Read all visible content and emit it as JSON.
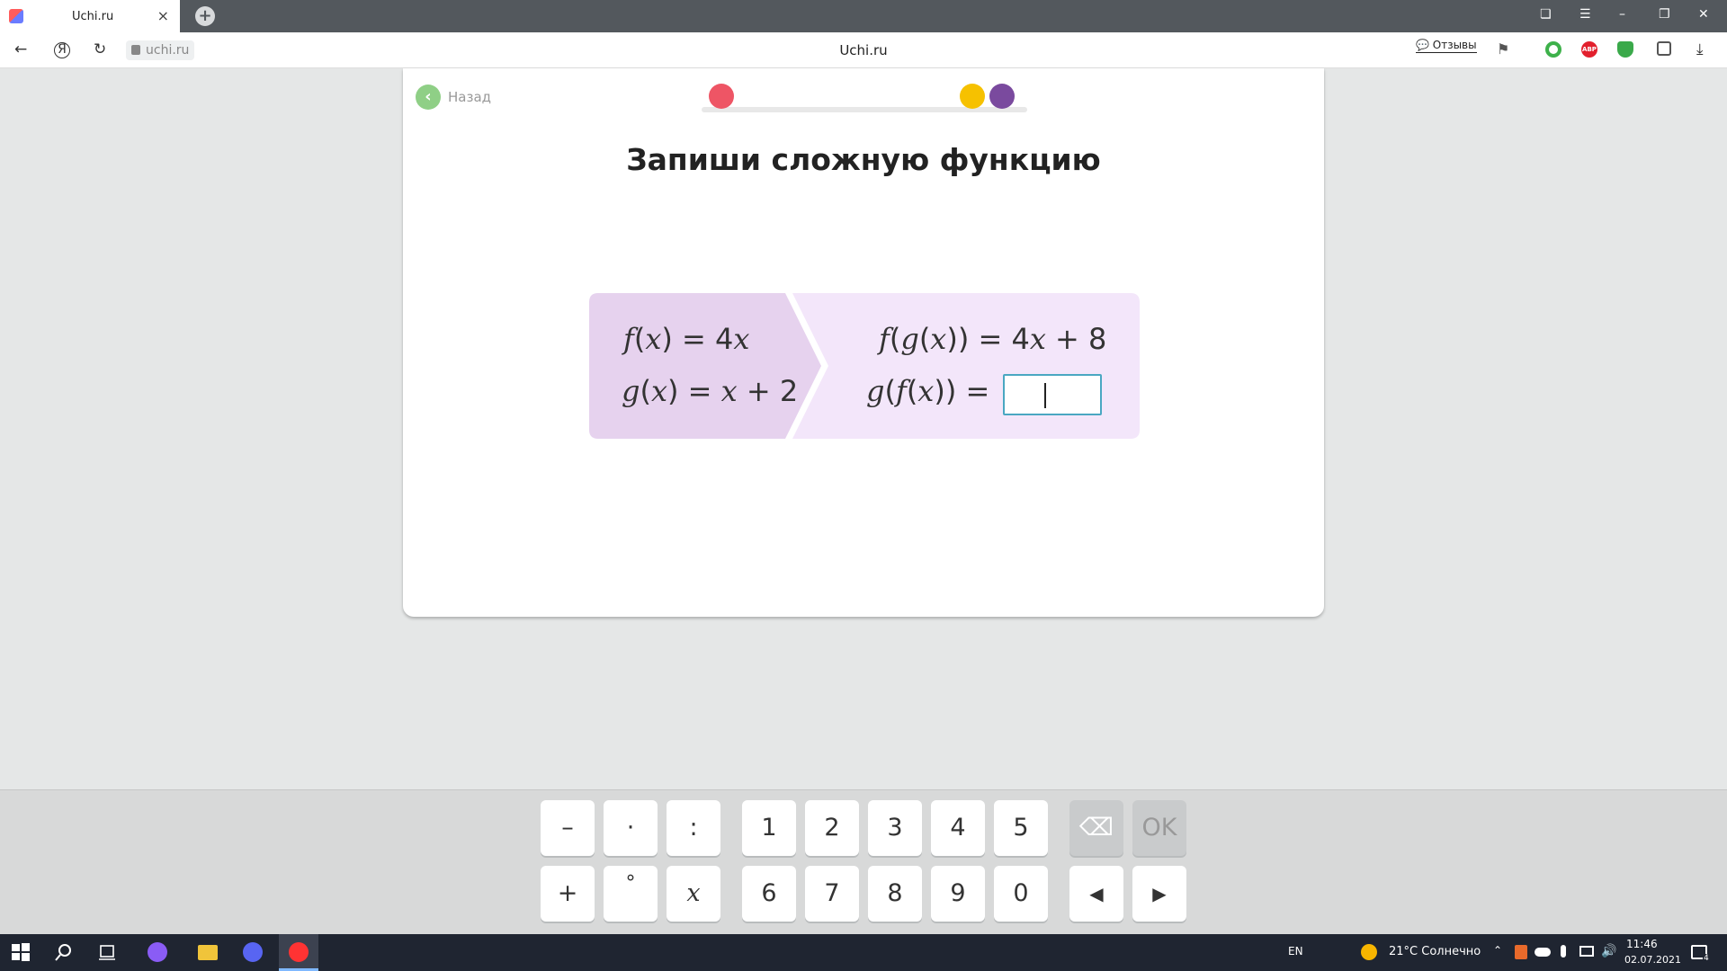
{
  "browser": {
    "tab_title": "Uchi.ru",
    "tab_close": "×",
    "new_tab": "+",
    "address": "uchi.ru",
    "page_title": "Uchi.ru",
    "feedback_label": "💬 Отзывы",
    "window_controls": {
      "menu": "☰",
      "minimize": "–",
      "restore": "❐",
      "close": "✕",
      "tabs": "❏"
    },
    "nav": {
      "back": "←",
      "home": "Я",
      "reload": "↻",
      "download": "⤓",
      "bookmark": "⚑"
    },
    "extensions": {
      "abp": "ABP"
    }
  },
  "page": {
    "back_label": "Назад",
    "back_arrow": "‹",
    "task_title": "Запиши сложную функцию",
    "progress_colors": {
      "current": "#ee5565",
      "next1": "#f6c100",
      "next2": "#7a4a9e"
    }
  },
  "math": {
    "f_def": {
      "name": "f",
      "arg": "x",
      "rhs_coef": "4",
      "rhs_var": "x"
    },
    "g_def": {
      "name": "g",
      "arg": "x",
      "rhs_var": "x",
      "rhs_rest": " + 2"
    },
    "fg": {
      "outer": "f",
      "inner": "g",
      "arg": "x",
      "rhs_coef": "4",
      "rhs_var": "x",
      "rhs_rest": " + 8"
    },
    "gf": {
      "outer": "g",
      "inner": "f",
      "arg": "x"
    },
    "answer_value": ""
  },
  "keyboard": {
    "row1_ops": [
      "–",
      "·",
      ":"
    ],
    "row2_ops": [
      "+",
      "°",
      "x"
    ],
    "row1_digits": [
      "1",
      "2",
      "3",
      "4",
      "5"
    ],
    "row2_digits": [
      "6",
      "7",
      "8",
      "9",
      "0"
    ],
    "backspace": "⌫",
    "ok": "OK",
    "left": "◀",
    "right": "▶"
  },
  "taskbar": {
    "lang": "EN",
    "weather": "21°C  Солнечно",
    "time": "11:46",
    "date": "02.07.2021",
    "notifications": "4"
  }
}
